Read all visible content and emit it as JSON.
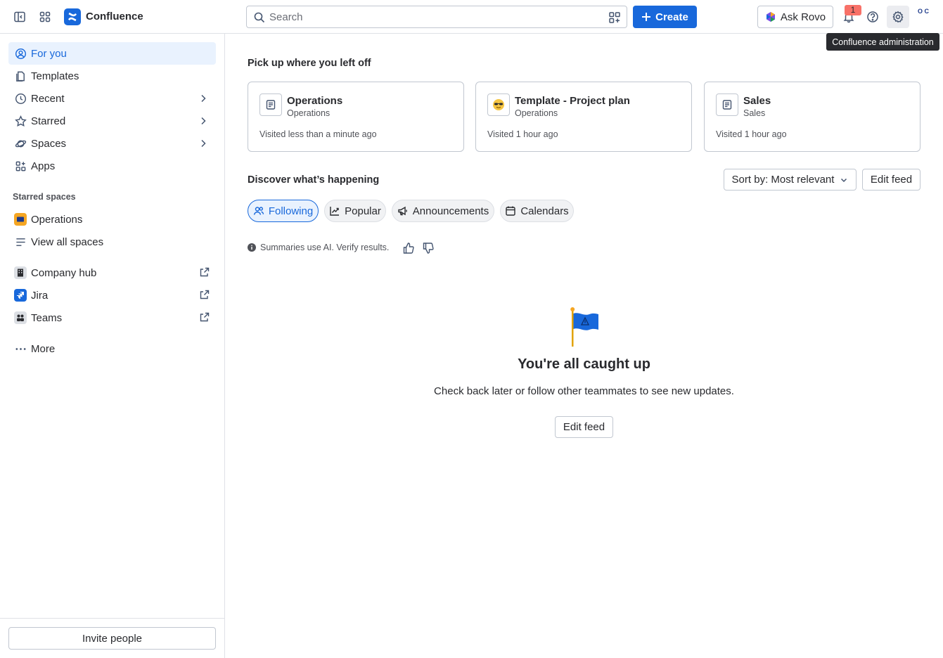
{
  "topbar": {
    "app_title": "Confluence",
    "search_placeholder": "Search",
    "create_label": "Create",
    "ask_rovo_label": "Ask Rovo",
    "notification_count": "1",
    "avatar_text": "O C",
    "tooltip": "Confluence administration",
    "icons": [
      "sidebar-toggle-icon",
      "app-switcher-icon",
      "search-icon",
      "qr-icon",
      "plus-icon",
      "bell-icon",
      "help-icon",
      "gear-icon"
    ]
  },
  "sidebar": {
    "items": [
      {
        "label": "For you",
        "icon": "person-circle-icon",
        "active": true
      },
      {
        "label": "Templates",
        "icon": "templates-icon"
      },
      {
        "label": "Recent",
        "icon": "clock-icon"
      },
      {
        "label": "Starred",
        "icon": "star-icon"
      },
      {
        "label": "Spaces",
        "icon": "planet-icon"
      },
      {
        "label": "Apps",
        "icon": "apps-icon"
      }
    ],
    "starred_spaces_label": "Starred spaces",
    "starred_spaces": [
      {
        "label": "Operations"
      },
      {
        "label": "View all spaces"
      }
    ],
    "external": [
      {
        "label": "Company hub"
      },
      {
        "label": "Jira"
      },
      {
        "label": "Teams"
      }
    ],
    "more_label": "More",
    "invite_label": "Invite people"
  },
  "main": {
    "pickup_title": "Pick up where you left off",
    "cards": [
      {
        "title": "Operations",
        "space": "Operations",
        "visited": "Visited less than a minute ago",
        "icon": "page-icon"
      },
      {
        "title": "Template - Project plan",
        "space": "Operations",
        "visited": "Visited 1 hour ago",
        "icon": "sunglasses-emoji-icon"
      },
      {
        "title": "Sales",
        "space": "Sales",
        "visited": "Visited 1 hour ago",
        "icon": "page-icon"
      }
    ],
    "discover_title": "Discover what’s happening",
    "sort_label": "Sort by: Most relevant",
    "edit_feed_label": "Edit feed",
    "tabs": [
      {
        "label": "Following",
        "selected": true
      },
      {
        "label": "Popular"
      },
      {
        "label": "Announcements"
      },
      {
        "label": "Calendars"
      }
    ],
    "ai_note": "Summaries use AI. Verify results.",
    "empty_title": "You're all caught up",
    "empty_sub": "Check back later or follow other teammates to see new updates.",
    "empty_button": "Edit feed"
  },
  "colors": {
    "accent": "#1868db",
    "selected_bg": "#e9f2fe",
    "badge": "#f87168",
    "border": "#c1c7d0"
  }
}
